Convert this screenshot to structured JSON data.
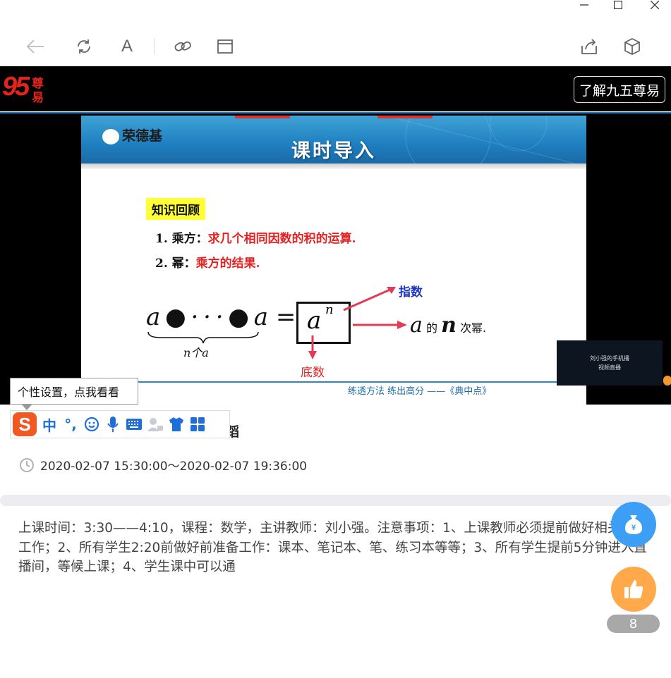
{
  "window": {
    "minimize": "–",
    "maximize": "☐",
    "close": "✕"
  },
  "toolbar": {
    "font_label": "A"
  },
  "brand": {
    "logo_main": "95",
    "logo_sub1": "尊",
    "logo_sub2": "易",
    "learn_button": "了解九五尊易"
  },
  "slide": {
    "brand": "荣德基",
    "title": "课时导入",
    "box_label": "知识回顾",
    "line1_num": "1. 乘方：",
    "line1_red": "求几个相同因数的积的运算.",
    "line2_num": "2. 幂：",
    "line2_red": "乘方的结果.",
    "exponent_label": "指数",
    "base_label": "底数",
    "n_count": "n个a",
    "power_text": "的",
    "power_text2": "次幂.",
    "footer": "练透方法 练出高分 ——《典中点》",
    "cam_line1": "刘小强的手机播",
    "cam_line2": "视频直播"
  },
  "ime": {
    "tooltip": "个性设置，点我看看",
    "mode": "中",
    "punct": "°,"
  },
  "session": {
    "time_range": "2020-02-07 15:30:00～2020-02-07 19:36:00"
  },
  "description": "上课时间：3:30——4:10，课程：数学，主讲教师：刘小强。注意事项：1、上课教师必须提前做好相关准备工作；2、所有学生2:20前做好前准备工作：课本、笔记本、笔、练习本等等；3、所有学生提前5分钟进入直播间，等候上课；4、学生课中可以通",
  "likes": {
    "count": "8"
  },
  "colors": {
    "accent_blue": "#3c9ef5",
    "like_orange": "#ffa94a",
    "slide_red": "#e52222"
  }
}
